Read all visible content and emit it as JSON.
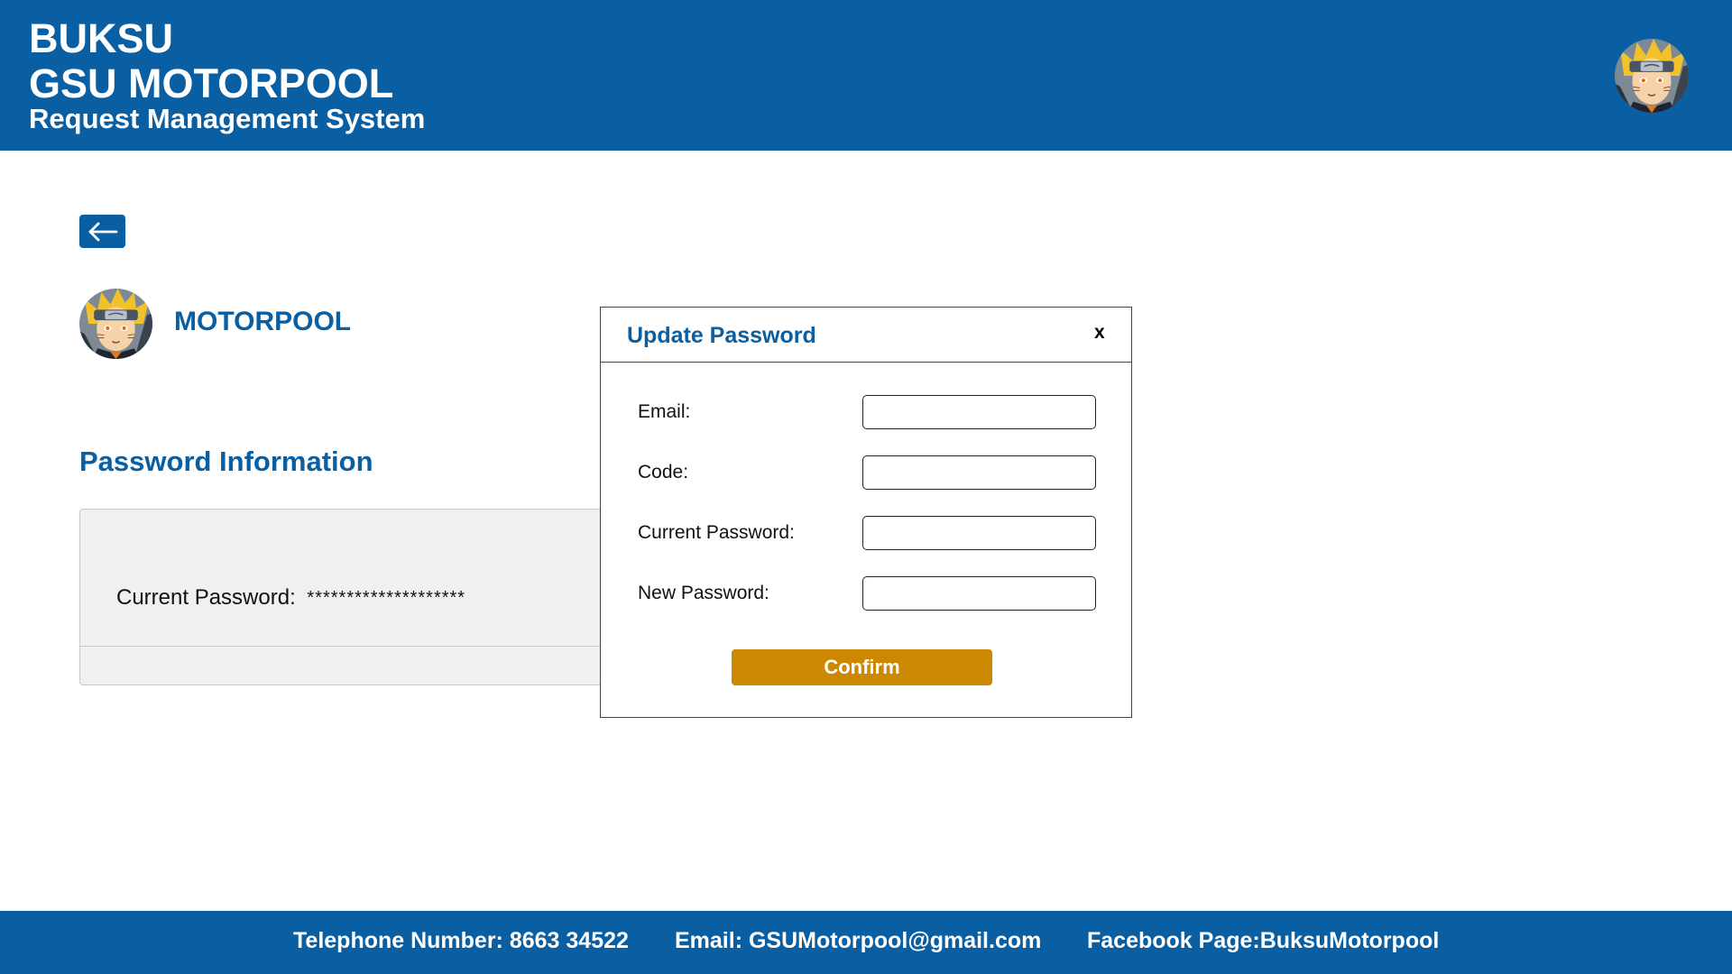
{
  "header": {
    "brand_line1": "BUKSU",
    "brand_line2": "GSU MOTORPOOL",
    "brand_line3": "Request Management System",
    "avatar_icon": "user-avatar-icon"
  },
  "nav": {
    "back_icon": "arrow-left-icon"
  },
  "profile": {
    "name": "MOTORPOOL"
  },
  "password_info": {
    "title": "Password Information",
    "current_password_label": "Current Password:",
    "current_password_value": "********************"
  },
  "modal": {
    "title": "Update Password",
    "close_label": "x",
    "fields": [
      {
        "label": "Email:",
        "value": ""
      },
      {
        "label": "Code:",
        "value": ""
      },
      {
        "label": "Current Password:",
        "value": ""
      },
      {
        "label": "New Password:",
        "value": ""
      }
    ],
    "confirm_label": "Confirm"
  },
  "footer": {
    "telephone": "Telephone Number: 8663 34522",
    "email": "Email: GSUMotorpool@gmail.com",
    "facebook": "Facebook Page:BuksuMotorpool"
  },
  "colors": {
    "primary": "#0a5fa3",
    "accent": "#cc8800",
    "card_bg": "#f0f0f0"
  }
}
